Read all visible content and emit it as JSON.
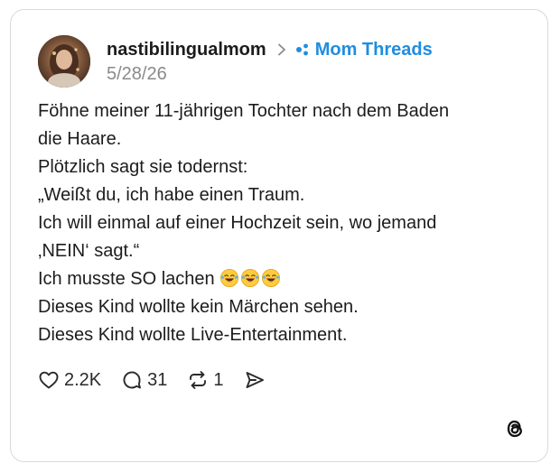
{
  "post": {
    "username": "nastibilingualmom",
    "community": "Mom Threads",
    "date": "5/28/26",
    "lines": [
      "Föhne meiner 11-jährigen Tochter nach dem Baden",
      "die Haare.",
      "Plötzlich sagt sie todernst:",
      "„Weißt du, ich habe einen Traum.",
      "Ich will einmal auf einer Hochzeit sein, wo jemand",
      "‚NEIN‘ sagt.“",
      "Ich musste SO lachen",
      "Dieses Kind wollte kein Märchen sehen.",
      "Dieses Kind wollte Live-Entertainment."
    ],
    "emoji_name": "face-with-tears-of-joy",
    "emoji_count": 3
  },
  "actions": {
    "likes": "2.2K",
    "replies": "31",
    "reposts": "1"
  },
  "colors": {
    "community": "#1f8de0",
    "text": "#1c1c1c",
    "date": "#8a8a8a",
    "border": "#d9d9d9"
  },
  "icons": [
    "chevron-right-icon",
    "community-dots-icon",
    "heart-icon",
    "comment-icon",
    "repost-icon",
    "share-icon",
    "threads-logo-icon"
  ]
}
